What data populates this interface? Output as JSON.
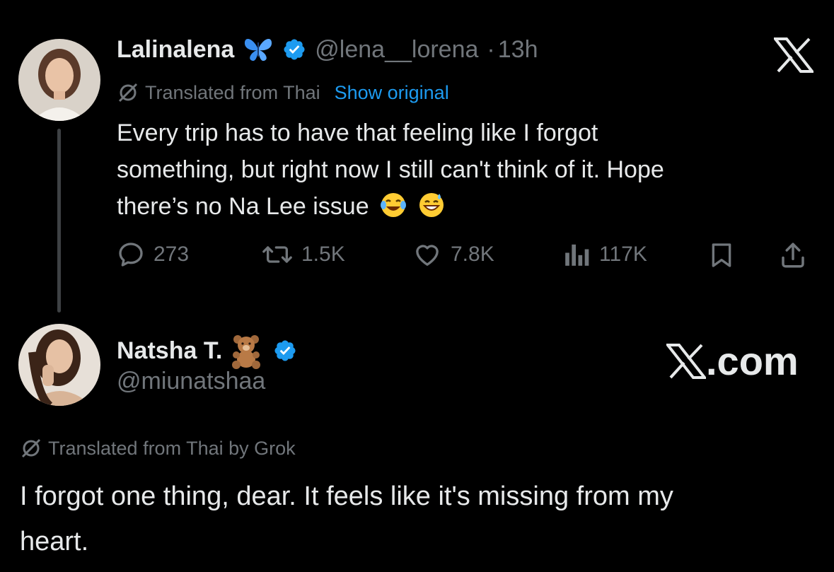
{
  "tweet1": {
    "display_name": "Lalinalena",
    "name_emoji": "butterfly-icon",
    "handle": "@lena__lorena",
    "separator": "·",
    "time": "13h",
    "translated_label": "Translated from Thai",
    "show_original": "Show original",
    "text_lines": [
      "Every trip has to have that feeling like I forgot",
      "something, but right now I still can't think of it. Hope",
      "there’s no Na Lee issue"
    ],
    "actions": {
      "replies": "273",
      "reposts": "1.5K",
      "likes": "7.8K",
      "views": "117K"
    }
  },
  "tweet2": {
    "display_name": "Natsha T.",
    "name_emoji": "teddy-bear-icon",
    "handle": "@miunatshaa",
    "translated_label": "Translated from Thai by Grok",
    "text_lines": [
      "I forgot one thing, dear. It feels like it's missing from my",
      "heart."
    ]
  },
  "branding": {
    "x_letter": "X",
    "x_domain_suffix": ".com"
  },
  "colors": {
    "background": "#000000",
    "text": "#e7e9ea",
    "muted": "#71767b",
    "link": "#1d9bf0",
    "verified": "#1d9bf0"
  }
}
